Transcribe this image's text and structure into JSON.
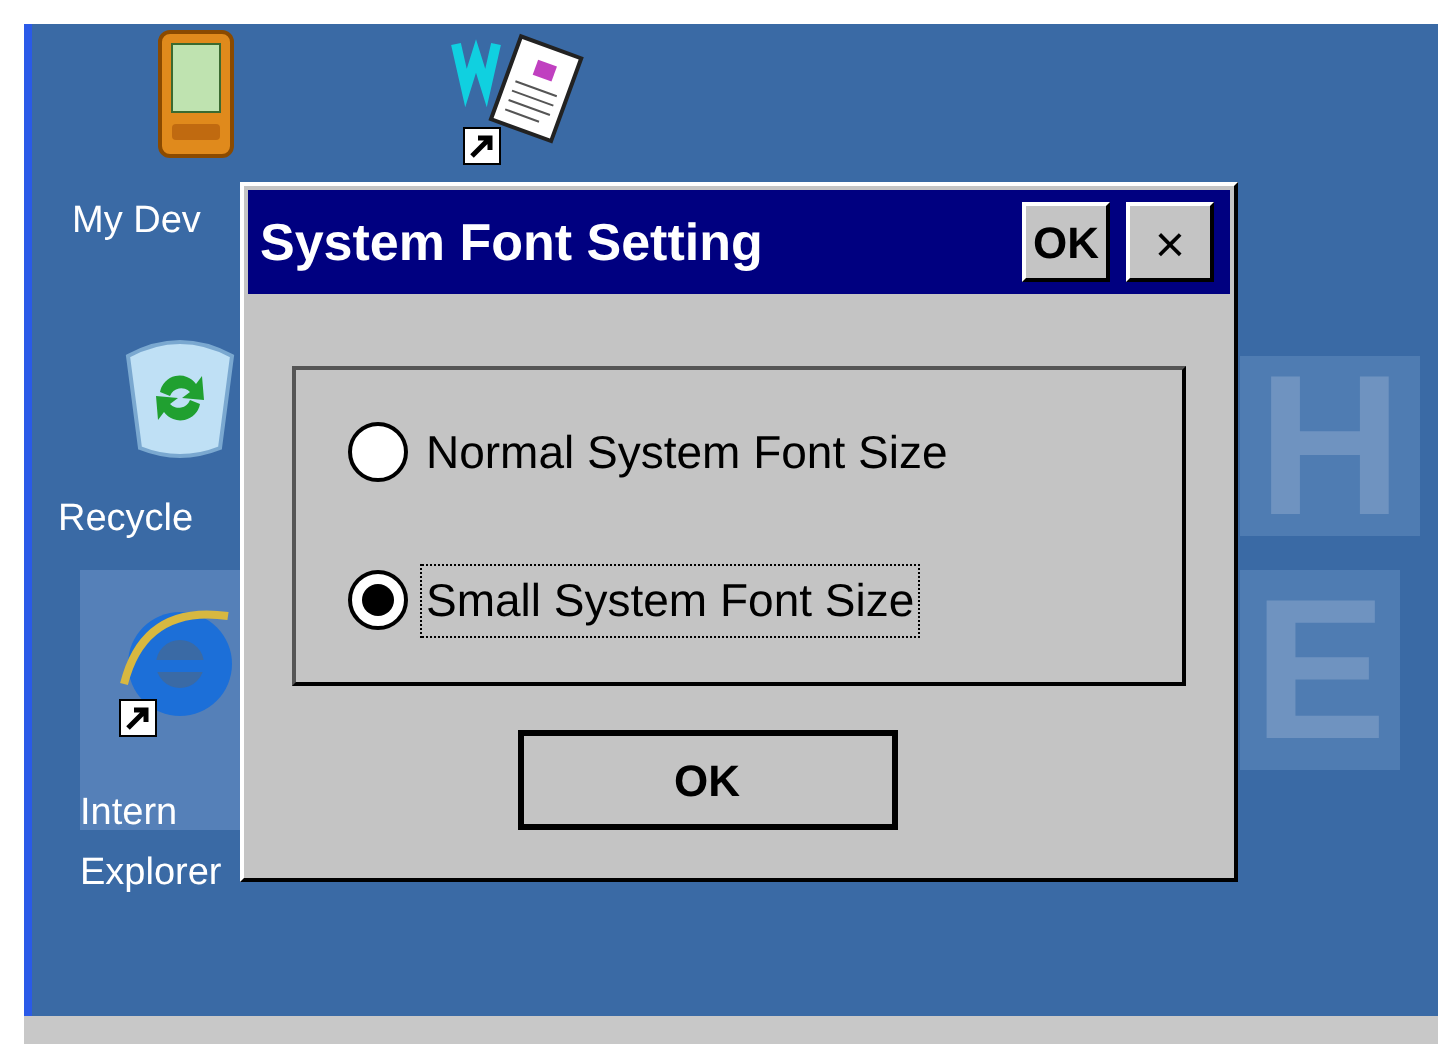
{
  "desktop": {
    "icons": [
      {
        "kind": "device",
        "label": "My Dev"
      },
      {
        "kind": "document"
      },
      {
        "kind": "recycle",
        "label": "Recycle"
      },
      {
        "kind": "browser",
        "label": "Intern\nExplorer"
      }
    ],
    "wallpaper_letters": [
      "H",
      "E"
    ]
  },
  "dialog": {
    "title": "System Font Setting",
    "title_ok": "OK",
    "close": "×",
    "options": [
      {
        "label": "Normal System Font Size",
        "selected": false
      },
      {
        "label": "Small System Font Size",
        "selected": true
      }
    ],
    "button": "OK"
  }
}
